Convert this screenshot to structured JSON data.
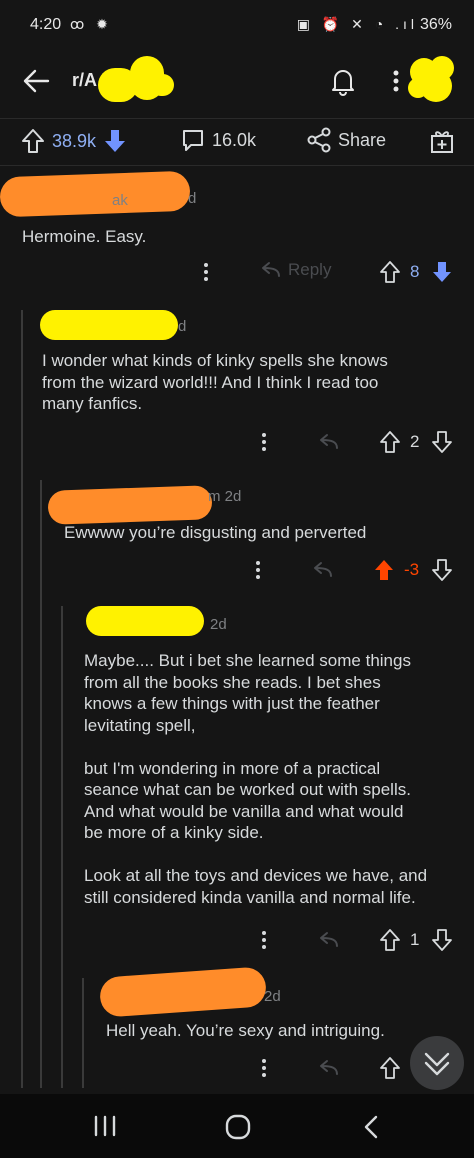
{
  "status": {
    "time": "4:20",
    "left_icons": "ꝏ ✹",
    "right_icons": "▣ ⏰ ✕ ◔ .ıl",
    "battery": "36%"
  },
  "header": {
    "subreddit": "r/A  R  d  t"
  },
  "post_actions": {
    "upvotes": "38.9k",
    "comments": "16.0k",
    "share_label": "Share"
  },
  "comments": [
    {
      "author_suffix": "ak",
      "age": "d",
      "body": "Hermoine. Easy.",
      "reply_label": "Reply",
      "score": "8",
      "vote_state": "down"
    },
    {
      "author_suffix": "",
      "age": "d",
      "body": "I wonder what kinds of kinky spells she knows\nfrom the wizard world!!! And I think I read too\nmany fanfics.",
      "score": "2",
      "vote_state": "none"
    },
    {
      "author_suffix": "",
      "age": "m 2d",
      "body": "Ewwww you’re disgusting and perverted",
      "score": "-3",
      "vote_state": "up"
    },
    {
      "author_suffix": "",
      "age": "2d",
      "body": "Maybe.... But i bet she learned some things\nfrom all the books she reads. I bet shes\nknows a few things with just the feather\nlevitating spell,\n\nbut I'm wondering in more of a practical\nseance what can be worked out with spells.\nAnd what would be vanilla and what would\nbe more of a kinky side.\n\nLook at all the toys and devices we have, and\nstill considered kinda vanilla and normal life.",
      "score": "1",
      "vote_state": "none"
    },
    {
      "author_suffix": "",
      "age": "2d",
      "body": "Hell yeah. You’re sexy and intriguing.",
      "score": "",
      "vote_state": "none"
    }
  ],
  "colors": {
    "background": "#151515",
    "upvote_blue": "#8faff3",
    "downvote_blue": "#7193ff",
    "upvote_orange": "#ff4500",
    "text": "#d7dadc",
    "meta": "#7f8184"
  }
}
